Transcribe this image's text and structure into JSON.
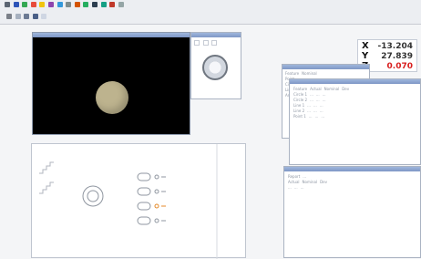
{
  "toolbar": {
    "icons": [
      "cursor-icon",
      "line-icon",
      "circle-icon",
      "arc-icon",
      "point-icon",
      "measure-icon",
      "zoom-icon",
      "grid-icon",
      "tool-icon",
      "light-icon",
      "camera-icon",
      "probe-icon",
      "report-icon",
      "settings-icon"
    ]
  },
  "dro": {
    "x_label": "X",
    "x_value": "-13.204",
    "y_label": "Y",
    "y_value": "27.839",
    "z_label": "Z",
    "z_value": "0.070"
  },
  "colors": {
    "accent": "#2d54b8",
    "value_red": "#d81d1d",
    "video_bg": "#000000",
    "circle": "#bdb38e",
    "cad_orange": "#e48a2a"
  }
}
